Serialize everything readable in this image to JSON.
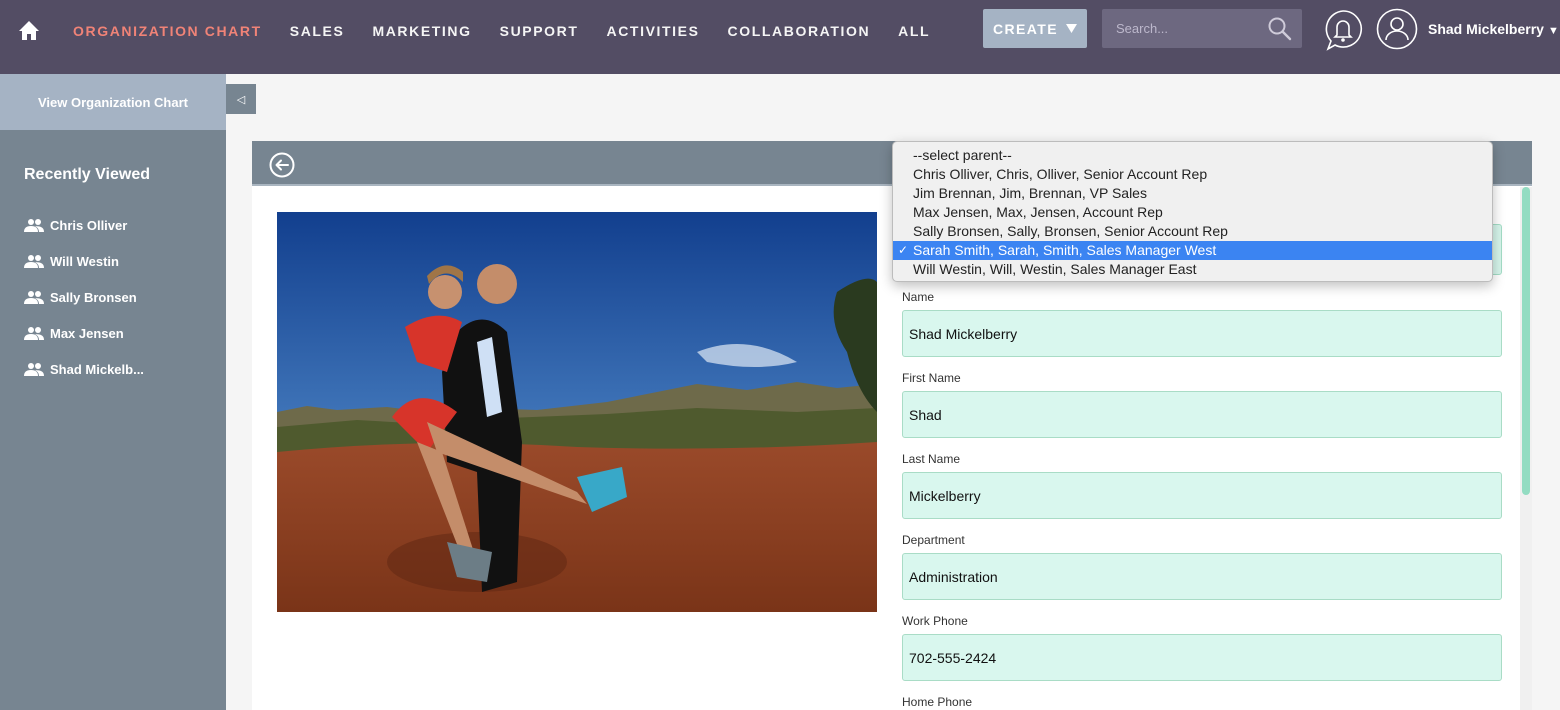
{
  "nav": {
    "items": [
      {
        "label": "ORGANIZATION CHART",
        "active": true
      },
      {
        "label": "SALES",
        "active": false
      },
      {
        "label": "MARKETING",
        "active": false
      },
      {
        "label": "SUPPORT",
        "active": false
      },
      {
        "label": "ACTIVITIES",
        "active": false
      },
      {
        "label": "COLLABORATION",
        "active": false
      },
      {
        "label": "ALL",
        "active": false
      }
    ],
    "create_label": "CREATE",
    "search_placeholder": "Search...",
    "user_name": "Shad Mickelberry"
  },
  "sidebar": {
    "top_link": "View Organization Chart",
    "recent_title": "Recently Viewed",
    "recent_items": [
      "Chris Olliver",
      "Will Westin",
      "Sally Bronsen",
      "Max Jensen",
      "Shad Mickelb..."
    ]
  },
  "dropdown": {
    "options": [
      "--select parent--",
      "Chris Olliver, Chris, Olliver, Senior Account Rep",
      "Jim Brennan, Jim, Brennan, VP Sales",
      "Max Jensen, Max, Jensen, Account Rep",
      "Sally Bronsen, Sally, Bronsen, Senior Account Rep",
      "Sarah Smith, Sarah, Smith, Sales Manager West",
      "Will Westin, Will, Westin, Sales Manager East"
    ],
    "selected_index": 5,
    "check_mark": "✓"
  },
  "form": {
    "fields": [
      {
        "label": "Name",
        "value": "Shad Mickelberry"
      },
      {
        "label": "First Name",
        "value": "Shad"
      },
      {
        "label": "Last Name",
        "value": "Mickelberry"
      },
      {
        "label": "Department",
        "value": "Administration"
      },
      {
        "label": "Work Phone",
        "value": "702-555-2424"
      },
      {
        "label": "Home Phone",
        "value": ""
      }
    ]
  },
  "colors": {
    "nav_bg": "#534d64",
    "accent": "#f08377",
    "field_bg": "#d9f7ee",
    "selected": "#3b84f2"
  }
}
